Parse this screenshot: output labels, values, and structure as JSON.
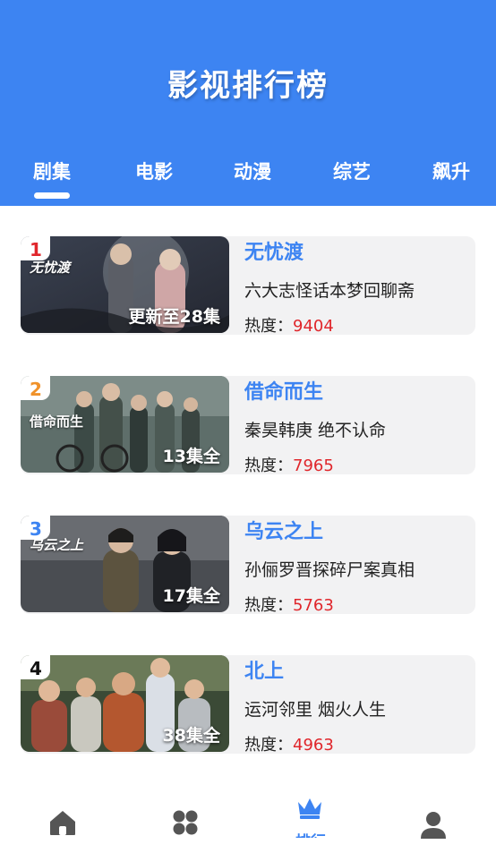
{
  "header": {
    "title": "影视排行榜"
  },
  "tabs": [
    {
      "label": "剧集",
      "active": true
    },
    {
      "label": "电影"
    },
    {
      "label": "动漫"
    },
    {
      "label": "综艺"
    },
    {
      "label": "飙升"
    }
  ],
  "items": [
    {
      "rank": "1",
      "rank_color": "#e0262b",
      "name": "无忧渡",
      "desc": "六大志怪话本梦回聊斋",
      "heat_label": "热度：",
      "heat": "9404",
      "episodes": "更新至28集",
      "poster_text": "无忧渡"
    },
    {
      "rank": "2",
      "rank_color": "#f0922a",
      "name": "借命而生",
      "desc": "秦昊韩庚 绝不认命",
      "heat_label": "热度：",
      "heat": "7965",
      "episodes": "13集全",
      "poster_text": "借命而生"
    },
    {
      "rank": "3",
      "rank_color": "#3d84f2",
      "name": "乌云之上",
      "desc": "孙俪罗晋探碎尸案真相",
      "heat_label": "热度：",
      "heat": "5763",
      "episodes": "17集全",
      "poster_text": "乌云之上"
    },
    {
      "rank": "4",
      "rank_color": "#111111",
      "name": "北上",
      "desc": "运河邻里 烟火人生",
      "heat_label": "热度：",
      "heat": "4963",
      "episodes": "38集全",
      "poster_text": ""
    }
  ],
  "bottom_nav": [
    {
      "icon": "home-icon"
    },
    {
      "icon": "grid-icon"
    },
    {
      "icon": "crown-icon",
      "label": "排行",
      "active": true
    },
    {
      "icon": "user-icon"
    }
  ],
  "colors": {
    "primary": "#3d84f2",
    "heat": "#e0262b",
    "card_bg": "#f2f2f3",
    "nav_inactive": "#555555"
  }
}
